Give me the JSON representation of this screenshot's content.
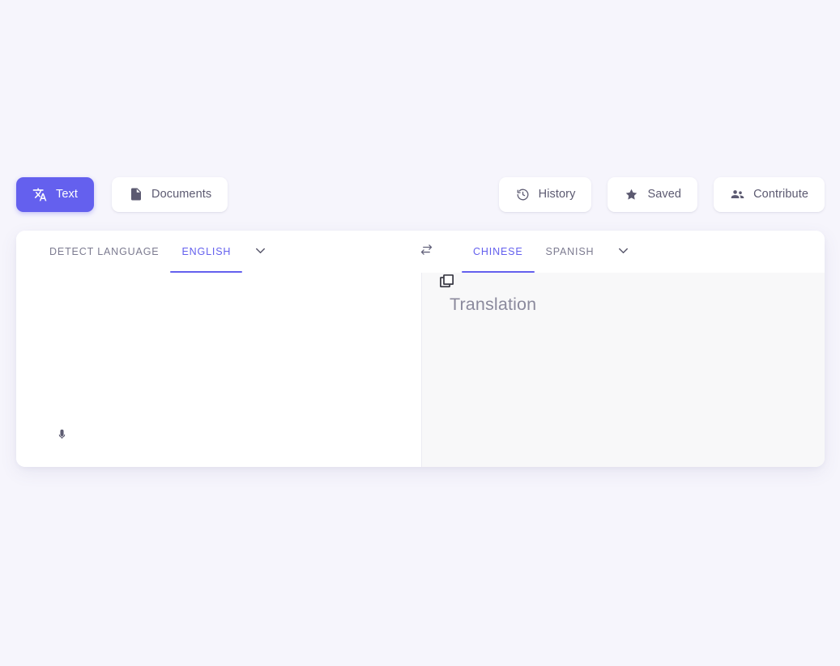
{
  "theme": {
    "page_background": "#f6f5fc",
    "accent": "#6460ee",
    "card_background": "#ffffff",
    "target_panel_background": "#f8f8f9",
    "muted_text": "#7c7b90"
  },
  "toolbar": {
    "left_buttons": [
      {
        "label": "Text",
        "icon": "translate-icon",
        "active": true
      },
      {
        "label": "Documents",
        "icon": "document-icon",
        "active": false
      }
    ],
    "right_buttons": [
      {
        "label": "History",
        "icon": "history-icon"
      },
      {
        "label": "Saved",
        "icon": "star-icon"
      },
      {
        "label": "Contribute",
        "icon": "people-icon"
      }
    ]
  },
  "language_bar": {
    "source": {
      "detect_label": "DETECT LANGUAGE",
      "selected_language": "ENGLISH",
      "dropdown_icon": "chevron-down-icon"
    },
    "swap_icon": "swap-horizontal-icon",
    "target": {
      "selected_language": "CHINESE",
      "alternate_language": "SPANISH",
      "dropdown_icon": "chevron-down-icon"
    }
  },
  "source_panel": {
    "text_value": "",
    "placeholder": "",
    "mic_icon": "microphone-icon"
  },
  "target_panel": {
    "placeholder": "Translation",
    "copy_icon": "copy-icon"
  }
}
